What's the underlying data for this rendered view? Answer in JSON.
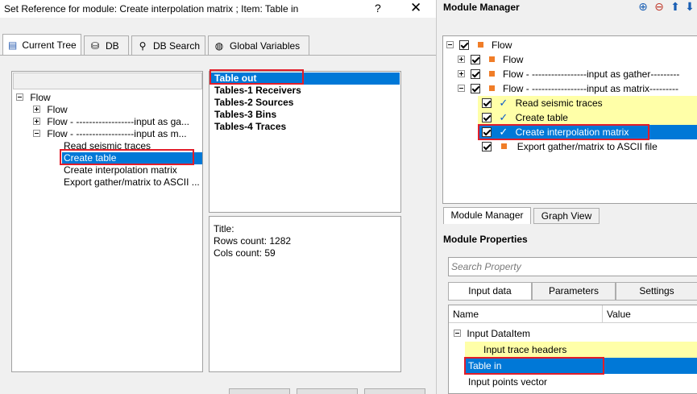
{
  "dialog": {
    "title": "Set Reference for module: Create interpolation matrix ; Item: Table in",
    "help_glyph": "?",
    "close_glyph": "✕",
    "tabs": [
      {
        "label": "Current Tree",
        "icon": "tree-icon"
      },
      {
        "label": "DB",
        "icon": "database-icon"
      },
      {
        "label": "DB Search",
        "icon": "search-icon"
      },
      {
        "label": "Global Variables",
        "icon": "globe-icon"
      }
    ],
    "tree": {
      "root": "Flow",
      "children": [
        "Flow",
        "Flow - ------------------input as ga...",
        "Flow - ------------------input as m..."
      ],
      "leaves": [
        "Read seismic traces",
        "Create table",
        "Create interpolation matrix",
        "Export gather/matrix to ASCII ..."
      ]
    },
    "tables": [
      "Table out",
      "Tables-1 Receivers",
      "Tables-2 Sources",
      "Tables-3 Bins",
      "Tables-4 Traces"
    ],
    "info": {
      "title_label": "Title:",
      "rows_label": "Rows count: 1282",
      "cols_label": "Cols count: 59"
    }
  },
  "module_manager": {
    "title": "Module Manager",
    "tree": {
      "root": "Flow",
      "flows": [
        "Flow",
        "Flow - -----------------input as gather---------",
        "Flow - -----------------input as matrix---------"
      ],
      "modules": [
        "Read seismic traces",
        "Create table",
        "Create interpolation matrix",
        "Export gather/matrix to ASCII file"
      ]
    },
    "tabs": [
      "Module Manager",
      "Graph View"
    ]
  },
  "module_properties": {
    "title": "Module Properties",
    "search_placeholder": "Search Property",
    "tabs": [
      "Input data",
      "Parameters",
      "Settings"
    ],
    "columns": [
      "Name",
      "Value"
    ],
    "rows": {
      "group": "Input DataItem",
      "trace_headers": "Input trace headers",
      "table_in": "Table in",
      "points_vector": "Input points vector"
    }
  },
  "colors": {
    "selection": "#0078d7",
    "highlight_yellow": "#ffffa8",
    "red_box": "#e21d2a",
    "module_square": "#f07d28"
  }
}
